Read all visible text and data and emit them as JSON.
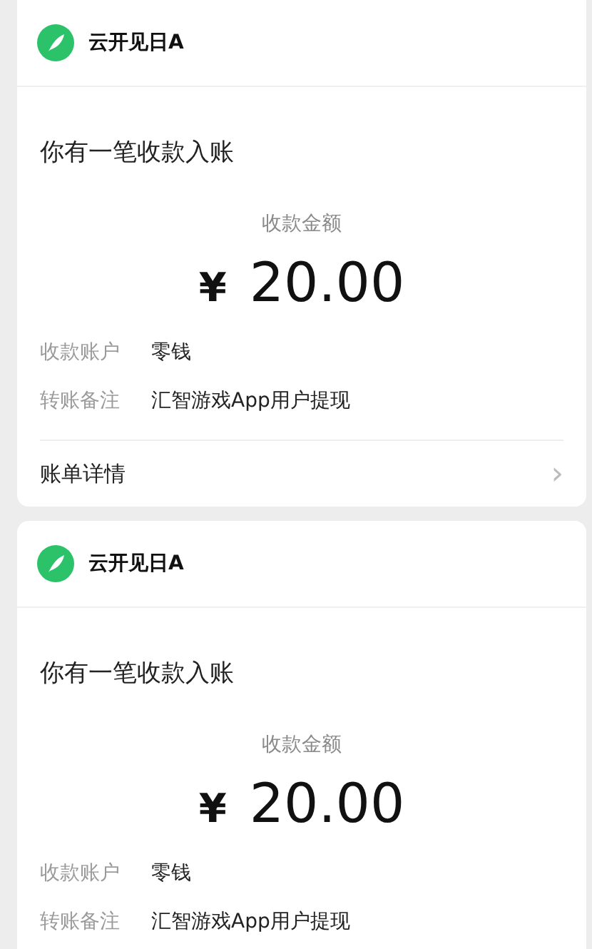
{
  "cards": [
    {
      "sender": "云开见日A",
      "title": "你有一笔收款入账",
      "amount_label": "收款金额",
      "currency": "¥",
      "amount": "20.00",
      "rows": [
        {
          "label": "收款账户",
          "value": "零钱"
        },
        {
          "label": "转账备注",
          "value": "汇智游戏App用户提现"
        }
      ],
      "footer": {
        "label": "账单详情",
        "chevron": "›"
      }
    },
    {
      "sender": "云开见日A",
      "title": "你有一笔收款入账",
      "amount_label": "收款金额",
      "currency": "¥",
      "amount": "20.00",
      "rows": [
        {
          "label": "收款账户",
          "value": "零钱"
        },
        {
          "label": "转账备注",
          "value": "汇智游戏App用户提现"
        }
      ]
    }
  ]
}
